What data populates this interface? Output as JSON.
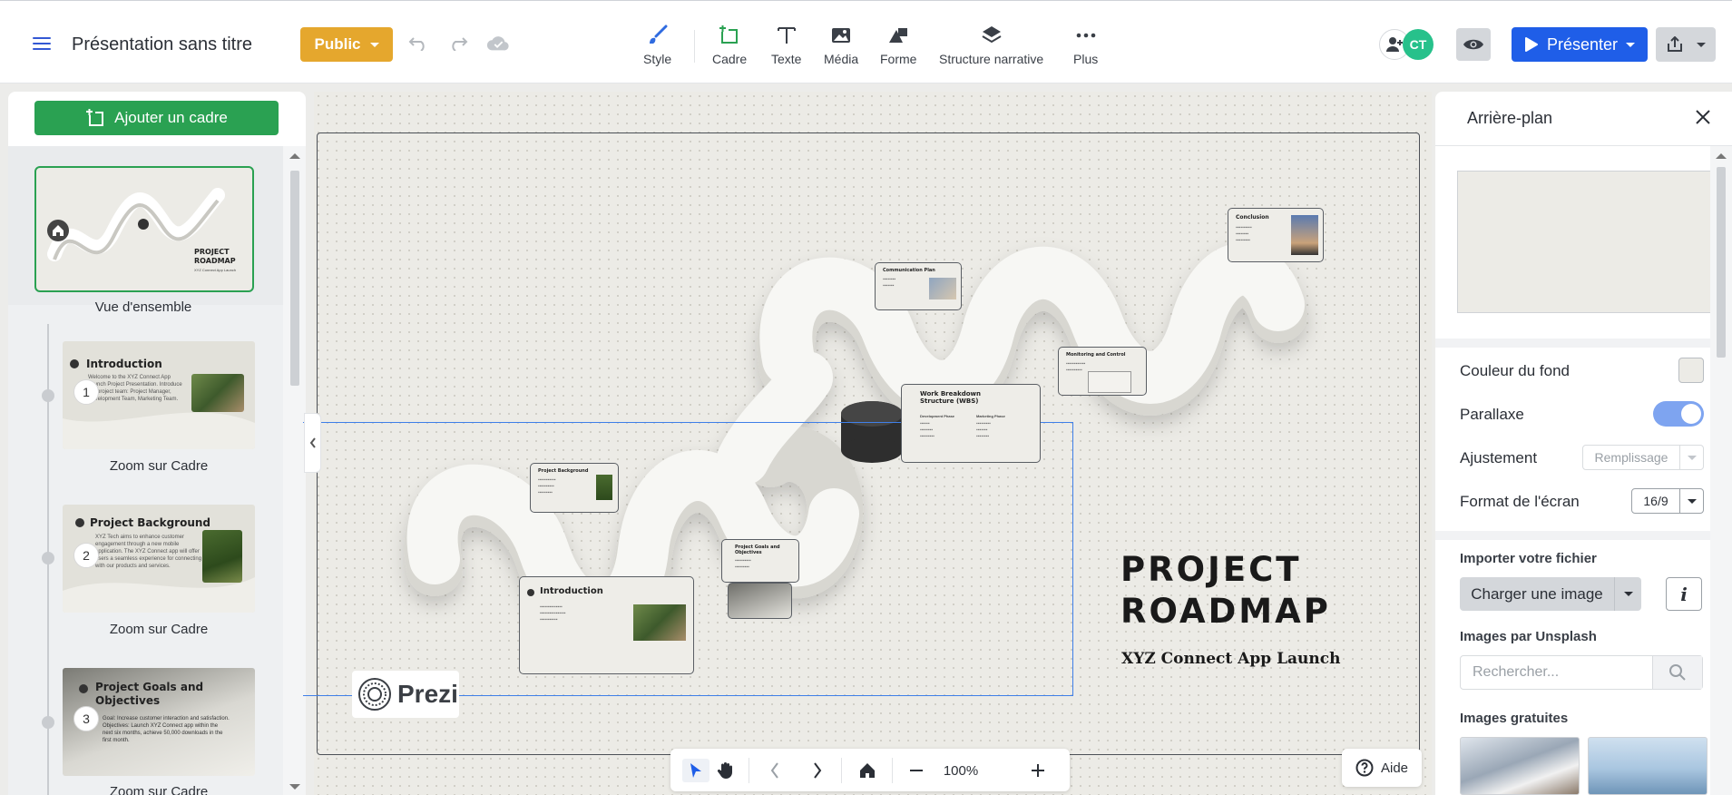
{
  "app": {
    "doc_title": "Présentation sans titre",
    "visibility_label": "Public"
  },
  "toolbar": {
    "tools": [
      {
        "label": "Style",
        "icon": "brush-icon"
      },
      {
        "label": "Cadre",
        "icon": "frame-icon"
      },
      {
        "label": "Texte",
        "icon": "text-icon"
      },
      {
        "label": "Média",
        "icon": "image-icon"
      },
      {
        "label": "Forme",
        "icon": "shapes-icon"
      },
      {
        "label": "Structure narrative",
        "icon": "layers-icon"
      },
      {
        "label": "Plus",
        "icon": "more-icon"
      }
    ],
    "avatar_initials": "CT",
    "present_label": "Présenter"
  },
  "left_panel": {
    "add_frame_label": "Ajouter un cadre",
    "overview_caption": "Vue d'ensemble",
    "overview_title": "PROJECT ROADMAP",
    "overview_subtitle": "XYZ Connect App Launch",
    "frames": [
      {
        "number": "1",
        "title": "Introduction",
        "text": "Welcome to the XYZ Connect App Launch Project Presentation. Introduce the project team: Project Manager, Development Team, Marketing Team.",
        "caption": "Zoom sur Cadre"
      },
      {
        "number": "2",
        "title": "Project Background",
        "text": "XYZ Tech aims to enhance customer engagement through a new mobile application. The XYZ Connect app will offer users a seamless experience for connecting with our products and services.",
        "caption": "Zoom sur Cadre"
      },
      {
        "number": "3",
        "title": "Project Goals and Objectives",
        "text": "Goal: Increase customer interaction and satisfaction. Objectives: Launch XYZ Connect app within the next six months, achieve 50,000 downloads in the first month.",
        "caption": "Zoom sur Cadre"
      }
    ]
  },
  "canvas": {
    "main_title_line1": "PROJECT",
    "main_title_line2": "ROADMAP",
    "main_subtitle": "XYZ Connect App Launch",
    "logo_text": "Prezi",
    "cards": {
      "conclusion": "Conclusion",
      "communication": "Communication Plan",
      "monitoring": "Monitoring and Control",
      "wbs": "Work Breakdown Structure (WBS)",
      "wbs_col1": "Development Phase",
      "wbs_col2": "Marketing Phase",
      "background": "Project Background",
      "goals": "Project Goals and Objectives",
      "intro": "Introduction"
    },
    "zoom_level": "100%",
    "help_label": "Aide"
  },
  "right_panel": {
    "title": "Arrière-plan",
    "bg_color_label": "Couleur du fond",
    "bg_color": "#ecebe6",
    "parallax_label": "Parallaxe",
    "parallax_on": true,
    "fit_label": "Ajustement",
    "fit_value": "Remplissage",
    "screen_format_label": "Format de l'écran",
    "screen_format_value": "16/9",
    "import_label": "Importer votre fichier",
    "upload_label": "Charger une image",
    "unsplash_label": "Images par Unsplash",
    "search_placeholder": "Rechercher...",
    "free_images_label": "Images gratuites"
  },
  "colors": {
    "accent_blue": "#1f5ee8",
    "public_yellow": "#e5a72d",
    "add_green": "#2aa152",
    "avatar_green": "#27c18b"
  }
}
